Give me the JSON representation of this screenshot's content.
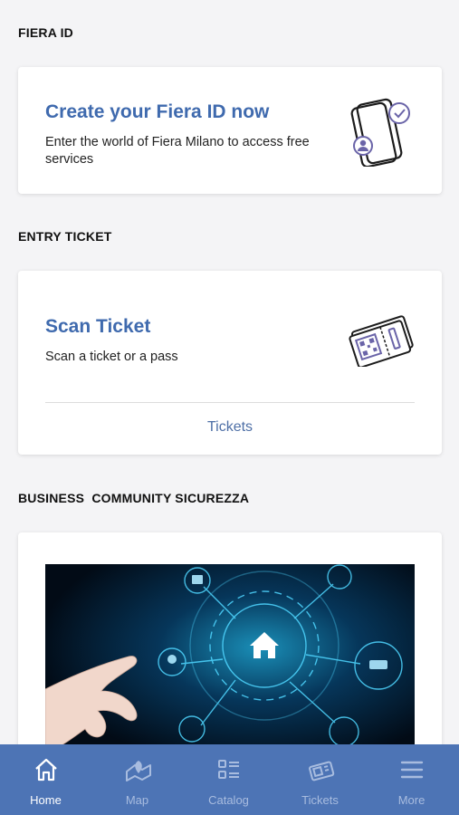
{
  "fiera_section": {
    "title": "FIERA ID",
    "card_title": "Create your Fiera ID now",
    "card_subtitle": "Enter the world of Fiera Milano to access free services",
    "icon": "phone-user-check-icon"
  },
  "ticket_section": {
    "title": "ENTRY TICKET",
    "card_title": "Scan Ticket",
    "card_subtitle": "Scan a ticket or a pass",
    "icon": "ticket-qr-icon",
    "link_label": "Tickets"
  },
  "business_section": {
    "title": "BUSINESS  COMMUNITY SICUREZZA",
    "image": "smart-home-security-image"
  },
  "tabs": [
    {
      "label": "Home",
      "icon": "home-icon",
      "active": true
    },
    {
      "label": "Map",
      "icon": "map-icon",
      "active": false
    },
    {
      "label": "Catalog",
      "icon": "catalog-icon",
      "active": false
    },
    {
      "label": "Tickets",
      "icon": "tickets-icon",
      "active": false
    },
    {
      "label": "More",
      "icon": "menu-icon",
      "active": false
    }
  ],
  "colors": {
    "accent": "#3f6aae",
    "tab_bar": "#4d74b5",
    "icon_purple": "#6a64a8"
  }
}
